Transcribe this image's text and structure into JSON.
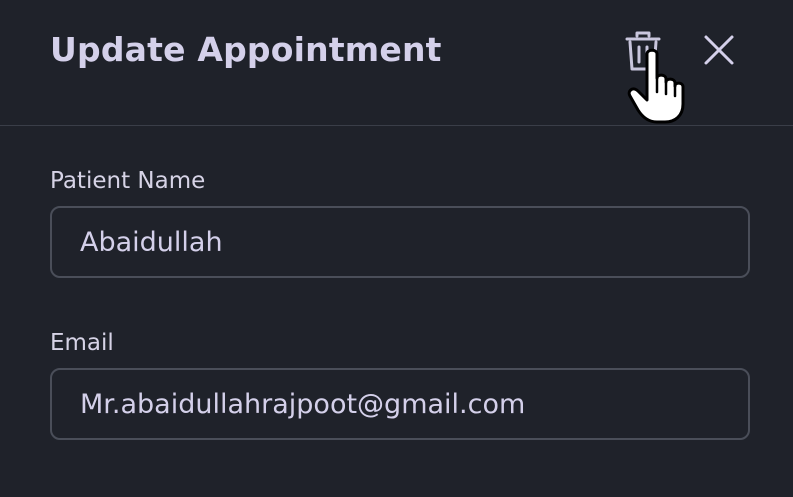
{
  "dialog": {
    "title": "Update Appointment",
    "delete_icon": "trash-icon",
    "close_icon": "close-icon"
  },
  "form": {
    "patient_name": {
      "label": "Patient Name",
      "value": "Abaidullah"
    },
    "email": {
      "label": "Email",
      "value": "Mr.abaidullahrajpoot@gmail.com"
    }
  },
  "colors": {
    "background": "#1f222a",
    "text": "#d4d0ea",
    "border": "#4a4e59",
    "divider": "#3a3e48"
  }
}
